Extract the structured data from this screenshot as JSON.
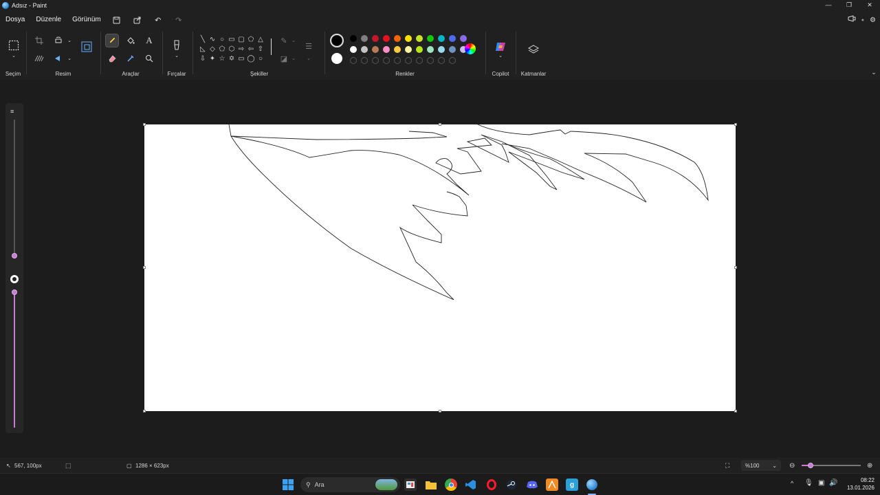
{
  "titlebar": {
    "title": "Adsız - Paint",
    "controls": [
      "—",
      "❐",
      "✕"
    ]
  },
  "menubar": {
    "items": [
      "Dosya",
      "Düzenle",
      "Görünüm"
    ]
  },
  "ribbon": {
    "groups": {
      "selection": "Seçim",
      "image": "Resim",
      "tools": "Araçlar",
      "brushes": "Fırçalar",
      "shapes": "Şekiller",
      "colors": "Renkler",
      "copilot": "Copilot",
      "layers": "Katmanlar"
    },
    "palette_row1": [
      "#000000",
      "#7f7f7f",
      "#c4172c",
      "#e81123",
      "#f7630c",
      "#fce100",
      "#c5e32a",
      "#16c60c",
      "#00b7c3",
      "#4f6bed",
      "#886ce4"
    ],
    "palette_row2": [
      "#ffffff",
      "#c3c3c3",
      "#b97a57",
      "#ff8ec6",
      "#ffc83d",
      "#fff4a3",
      "#b5e61d",
      "#9fe2bf",
      "#99d9ea",
      "#7092be",
      "#c8bfe7"
    ],
    "primary_color": "#000000",
    "secondary_color": "#ffffff"
  },
  "status": {
    "cursor_pos": "567, 100px",
    "canvas_size": "1286 × 623px",
    "zoom": "%100"
  },
  "taskbar": {
    "search_placeholder": "Ara",
    "time": "08:22",
    "date": "13.01.2026"
  }
}
